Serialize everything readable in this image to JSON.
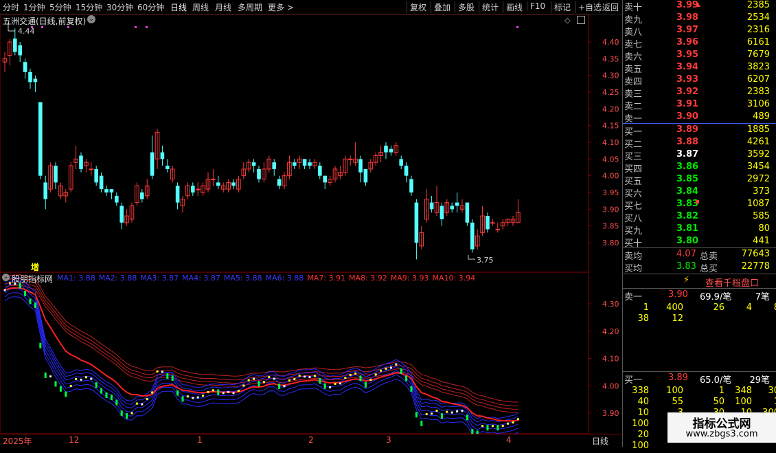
{
  "toolbar": {
    "periods": [
      "分时",
      "1分钟",
      "5分钟",
      "15分钟",
      "30分钟",
      "60分钟",
      "日线",
      "周线",
      "月线",
      "多周期",
      "更多"
    ],
    "active_period": "日线",
    "buttons": [
      "复权",
      "叠加",
      "多股",
      "统计",
      "画线",
      "F10",
      "标记",
      "+自选",
      "返回"
    ]
  },
  "main_chart": {
    "title": "五洲交通(日线,前复权)",
    "high_label": "4.44",
    "low_label": "3.75",
    "price_ticks": [
      "4.40",
      "4.35",
      "4.30",
      "4.25",
      "4.20",
      "4.15",
      "4.10",
      "4.05",
      "4.00",
      "3.95",
      "3.90",
      "3.85",
      "3.80"
    ],
    "badge": "增"
  },
  "indicator": {
    "name": "股朋指标网",
    "legend": [
      {
        "label": "MA1: 3.88",
        "color": "#3a3aff"
      },
      {
        "label": "MA2: 3.88",
        "color": "#3a3aff"
      },
      {
        "label": "MA3: 3.87",
        "color": "#3a3aff"
      },
      {
        "label": "MA4: 3.87",
        "color": "#3a3aff"
      },
      {
        "label": "MA5: 3.88",
        "color": "#3a3aff"
      },
      {
        "label": "MA6: 3.88",
        "color": "#3a3aff"
      },
      {
        "label": "MA7: 3.91",
        "color": "#ff3030"
      },
      {
        "label": "MA8: 3.92",
        "color": "#ff3030"
      },
      {
        "label": "MA9: 3.93",
        "color": "#ff3030"
      },
      {
        "label": "MA10: 3.94",
        "color": "#ff3030"
      }
    ],
    "ticks": [
      "4.30",
      "4.20",
      "4.10",
      "4.00",
      "3.90"
    ]
  },
  "time_axis": {
    "labels": [
      "2025年",
      "12",
      "1",
      "2",
      "3",
      "4"
    ],
    "period_button": "日线"
  },
  "order_book": {
    "sell": [
      {
        "label": "卖十",
        "price": "3.99",
        "vol": "2385"
      },
      {
        "label": "卖九",
        "price": "3.98",
        "vol": "2534"
      },
      {
        "label": "卖八",
        "price": "3.97",
        "vol": "2316"
      },
      {
        "label": "卖七",
        "price": "3.96",
        "vol": "6161"
      },
      {
        "label": "卖六",
        "price": "3.95",
        "vol": "7679"
      },
      {
        "label": "卖五",
        "price": "3.94",
        "vol": "3823"
      },
      {
        "label": "卖四",
        "price": "3.93",
        "vol": "6207"
      },
      {
        "label": "卖三",
        "price": "3.92",
        "vol": "2383"
      },
      {
        "label": "卖二",
        "price": "3.91",
        "vol": "3106"
      },
      {
        "label": "卖一",
        "price": "3.90",
        "vol": "489"
      }
    ],
    "buy": [
      {
        "label": "买一",
        "price": "3.89",
        "vol": "1885",
        "color": "red"
      },
      {
        "label": "买二",
        "price": "3.88",
        "vol": "4261",
        "color": "red"
      },
      {
        "label": "买三",
        "price": "3.87",
        "vol": "3592",
        "color": "white"
      },
      {
        "label": "买四",
        "price": "3.86",
        "vol": "3454",
        "color": "green"
      },
      {
        "label": "买五",
        "price": "3.85",
        "vol": "2972",
        "color": "green"
      },
      {
        "label": "买六",
        "price": "3.84",
        "vol": "373",
        "color": "green"
      },
      {
        "label": "买七",
        "price": "3.83",
        "vol": "1087",
        "color": "green"
      },
      {
        "label": "买八",
        "price": "3.82",
        "vol": "585",
        "color": "green"
      },
      {
        "label": "买九",
        "price": "3.81",
        "vol": "80",
        "color": "green"
      },
      {
        "label": "买十",
        "price": "3.80",
        "vol": "441",
        "color": "green"
      }
    ],
    "avg_sell_label": "卖均",
    "avg_sell": "4.07",
    "total_sell_label": "总卖",
    "total_sell": "77643",
    "avg_buy_label": "买均",
    "avg_buy": "3.83",
    "total_buy_label": "总买",
    "total_buy": "22778"
  },
  "detail": {
    "link": "查看千档盘口",
    "sell1": {
      "label": "卖一",
      "price": "3.90",
      "avg": "69.9/笔",
      "count": "7笔"
    },
    "sell1_rows": [
      [
        "1",
        "400",
        "26",
        "4",
        "8"
      ],
      [
        "38",
        "12",
        "",
        "",
        ""
      ]
    ],
    "buy1": {
      "label": "买一",
      "price": "3.89",
      "avg": "65.0/笔",
      "count": "29笔"
    },
    "buy1_rows": [
      [
        "338",
        "100",
        "1",
        "348",
        "30"
      ],
      [
        "40",
        "55",
        "50",
        "100",
        "1"
      ],
      [
        "10",
        "3",
        "30",
        "10",
        "300"
      ],
      [
        "100",
        "5",
        "",
        "",
        ""
      ],
      [
        "20",
        "",
        "",
        "",
        ""
      ],
      [
        "100",
        "",
        "",
        "",
        ""
      ]
    ]
  },
  "watermark": {
    "title": "指标公式网",
    "url": "www.zbgs3.com"
  },
  "colors": {
    "up": "#ff3a3a",
    "down": "#54ffff",
    "ma_blue": "#3a3aff",
    "ma_red": "#ff3030",
    "grid": "#8b0000"
  }
}
